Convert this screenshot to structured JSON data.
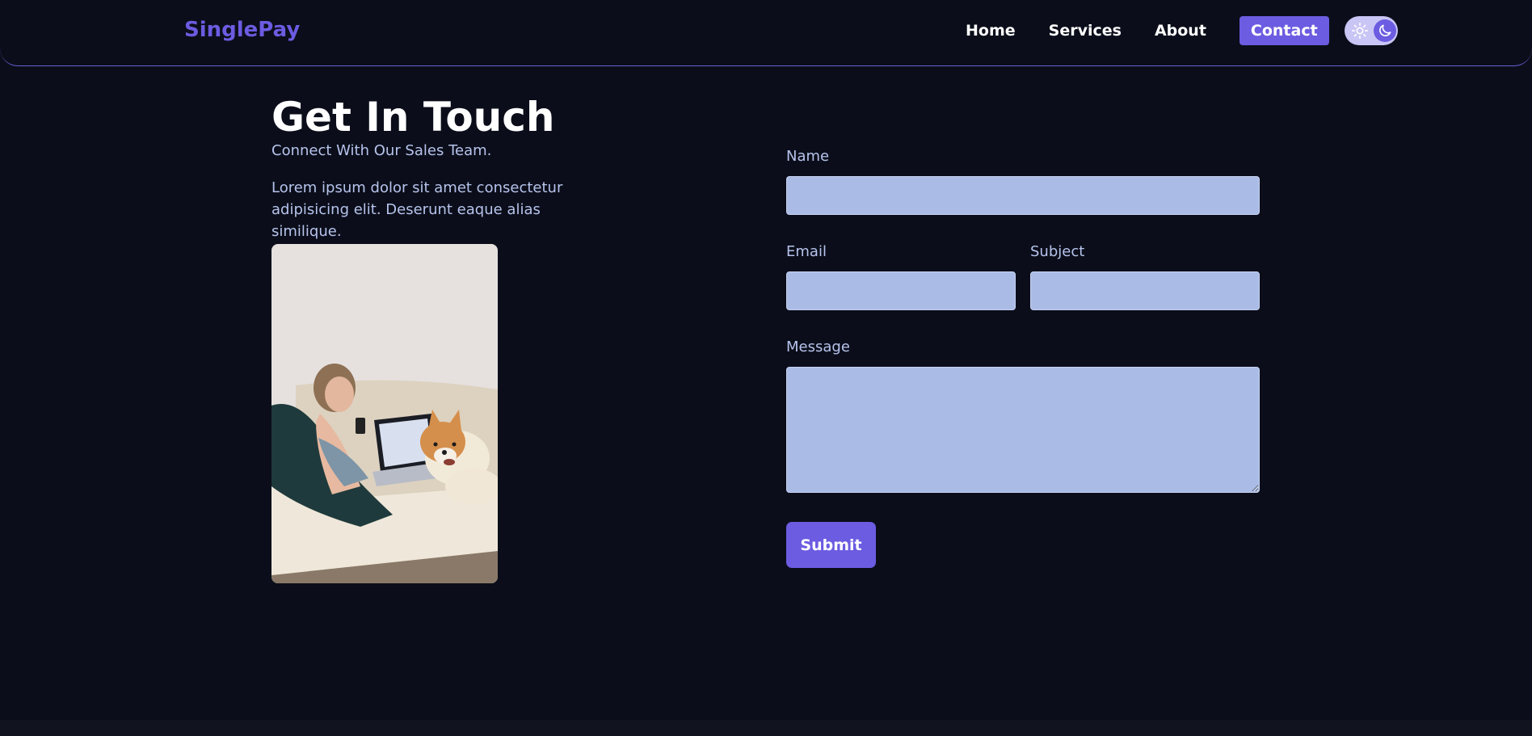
{
  "header": {
    "logo": "SinglePay",
    "nav": [
      "Home",
      "Services",
      "About",
      "Contact"
    ],
    "active_nav": "Contact"
  },
  "theme_toggle": {
    "light_icon": "sun-icon",
    "dark_icon": "moon-icon"
  },
  "contact": {
    "title": "Get In Touch",
    "subtitle": "Connect With Our Sales Team.",
    "description": "Lorem ipsum dolor sit amet consectetur adipisicing elit. Deserunt eaque alias similique."
  },
  "form": {
    "name_label": "Name",
    "email_label": "Email",
    "subject_label": "Subject",
    "message_label": "Message",
    "name_value": "",
    "email_value": "",
    "subject_value": "",
    "message_value": "",
    "submit_label": "Submit"
  },
  "colors": {
    "background": "#0b0e1a",
    "accent": "#6b5ce1",
    "field_background": "#aabce6",
    "text_muted": "#b6c3ec"
  }
}
